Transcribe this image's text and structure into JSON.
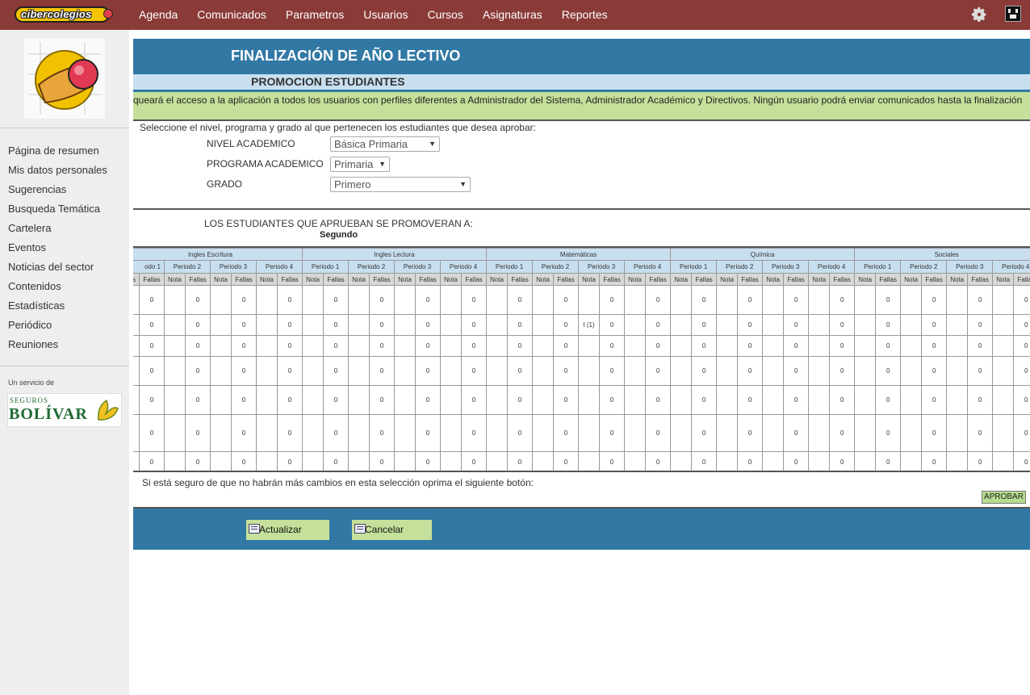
{
  "app": {
    "logo_text": "cibercolegios"
  },
  "nav": {
    "items": [
      "Agenda",
      "Comunicados",
      "Parametros",
      "Usuarios",
      "Cursos",
      "Asignaturas",
      "Reportes"
    ]
  },
  "sidebar": {
    "menu": [
      "Página de resumen",
      "Mis datos personales",
      "Sugerencias",
      "Busqueda Temática",
      "Cartelera",
      "Eventos",
      "Noticias del sector",
      "Contenidos",
      "Estadísticas",
      "Periódico",
      "Reuniones"
    ],
    "service_label": "Un servicio de",
    "sponsor_top": "SEGUROS",
    "sponsor_name": "BOLÍVAR"
  },
  "page": {
    "title": "FINALIZACIÓN DE AÑO LECTIVO",
    "subtitle": "PROMOCION ESTUDIANTES",
    "warning": "queará el acceso a la aplicación a todos los usuarios con perfiles diferentes a Administrador del Sistema, Administrador Académico y Directivos. Ningún usuario podrá enviar comunicados hasta la finalización",
    "select_intro": "Seleccione el nivel, programa y grado al que pertenecen los estudiantes que desea aprobar:",
    "fields": {
      "nivel_label": "NIVEL ACADEMICO",
      "nivel_value": "Básica Primaria",
      "programa_label": "PROGRAMA ACADEMICO",
      "programa_value": "Primaria",
      "grado_label": "GRADO",
      "grado_value": "Primero"
    },
    "promote_label": "LOS ESTUDIANTES QUE APRUEBAN SE PROMOVERAN A:",
    "promote_grade": "Segundo",
    "confirm_text": "Si está seguro de que no habrán más cambios en esta selección oprima el siguiente botón:",
    "approve_label": "APROBAR",
    "update_label": "Actualizar",
    "cancel_label": "Cancelar"
  },
  "grades": {
    "subjects": [
      "Ingles Escritura",
      "Ingles Lectura",
      "Matemáticas",
      "Química",
      "Sociales"
    ],
    "periods": [
      "Periodo 1",
      "Periodo 2",
      "Periodo 3",
      "Periodo 4"
    ],
    "first_period_fragment": "odo 1",
    "nota_label": "Nota",
    "fallas_label": "Fallas",
    "fallas_value": "0",
    "special_note": {
      "row": 1,
      "subject": 2,
      "period": 2,
      "value": "I (1)"
    },
    "row_count": 7
  }
}
